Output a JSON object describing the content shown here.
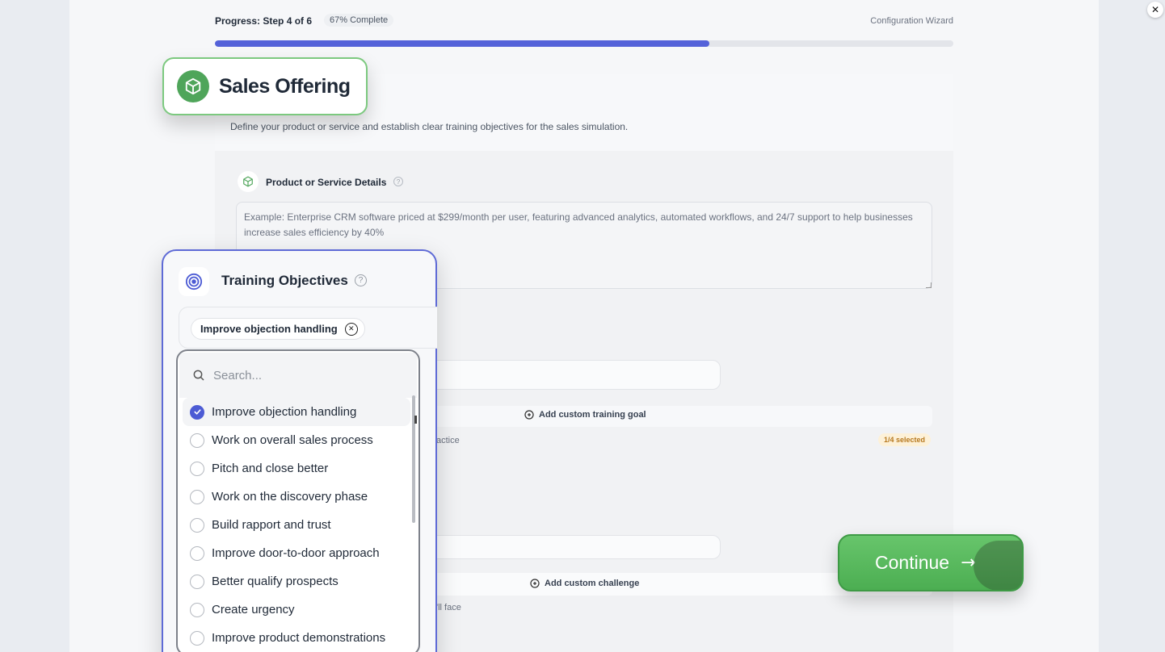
{
  "close_glyph": "✕",
  "progress": {
    "label": "Progress: Step 4 of 6",
    "percent_label": "67% Complete",
    "percent": 67,
    "wizard_label": "Configuration Wizard"
  },
  "colors": {
    "accent": "#5462d9",
    "success": "#4fa55a"
  },
  "sales_offering": {
    "title": "Sales Offering",
    "icon": "package-icon",
    "subtitle": "Define your product or service and establish clear training objectives for the sales simulation."
  },
  "product_details": {
    "label": "Product or Service Details",
    "help": "?",
    "placeholder": "Example: Enterprise CRM software priced at $299/month per user, featuring advanced analytics, automated workflows, and 24/7 support to help businesses increase sales efficiency by 40%"
  },
  "training_objectives": {
    "title": "Training Objectives",
    "help": "?",
    "selected_chip": "Improve objection handling",
    "search_placeholder": "Search...",
    "options": [
      {
        "label": "Improve objection handling",
        "selected": true
      },
      {
        "label": "Work on overall sales process",
        "selected": false
      },
      {
        "label": "Pitch and close better",
        "selected": false
      },
      {
        "label": "Work on the discovery phase",
        "selected": false
      },
      {
        "label": "Build rapport and trust",
        "selected": false
      },
      {
        "label": "Improve door-to-door approach",
        "selected": false
      },
      {
        "label": "Better qualify prospects",
        "selected": false
      },
      {
        "label": "Create urgency",
        "selected": false
      },
      {
        "label": "Improve product demonstrations",
        "selected": false
      }
    ],
    "add_goal_label": "Add custom training goal",
    "practice_text": "actice",
    "selected_badge": "1/4 selected"
  },
  "challenges": {
    "add_label": "Add custom challenge",
    "face_text": "'ll face"
  },
  "continue_button": {
    "label": "Continue",
    "arrow": "→"
  }
}
